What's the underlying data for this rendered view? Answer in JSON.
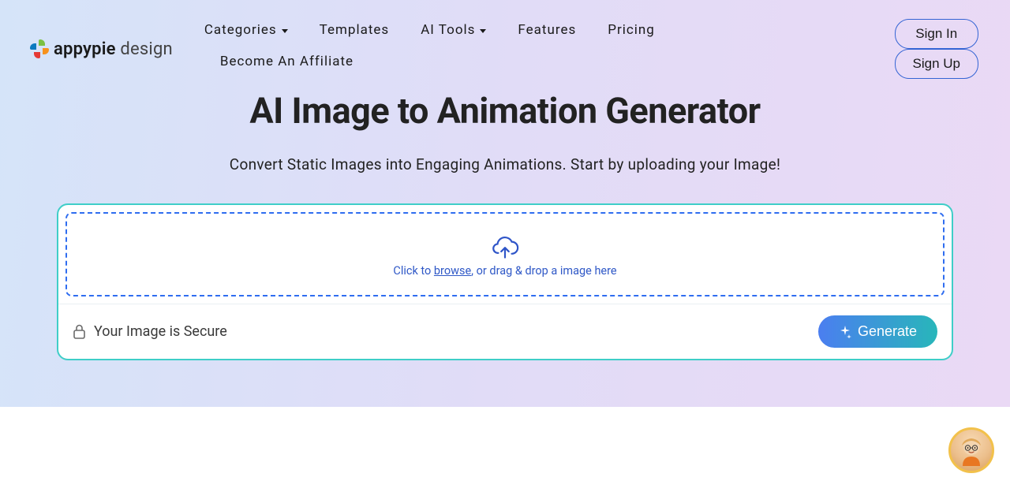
{
  "brand": {
    "name_bold": "appypie",
    "name_light": "design"
  },
  "nav": {
    "items": [
      {
        "label": "Categories",
        "dropdown": true
      },
      {
        "label": "Templates",
        "dropdown": false
      },
      {
        "label": "AI Tools",
        "dropdown": true
      },
      {
        "label": "Features",
        "dropdown": false
      },
      {
        "label": "Pricing",
        "dropdown": false
      },
      {
        "label": "Become An Affiliate",
        "dropdown": false
      }
    ]
  },
  "auth": {
    "sign_in": "Sign In",
    "sign_up": "Sign Up"
  },
  "hero": {
    "title": "AI Image to Animation Generator",
    "subtitle": "Convert Static Images into Engaging Animations. Start by uploading your Image!"
  },
  "upload": {
    "prefix": "Click to ",
    "browse": "browse",
    "suffix": ", or drag & drop a image here",
    "secure": "Your Image is Secure",
    "generate": "Generate"
  }
}
